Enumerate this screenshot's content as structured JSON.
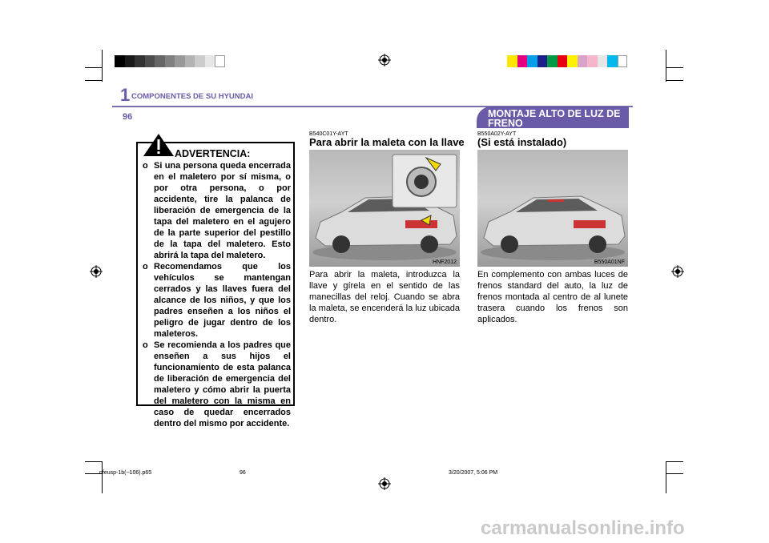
{
  "header": {
    "chapter_number": "1",
    "chapter_title": "COMPONENTES DE SU HYUNDAI",
    "page_number": "96",
    "section_title": "MONTAJE ALTO DE LUZ DE FRENO"
  },
  "warning": {
    "icon": "exclamation-icon",
    "title": "ADVERTENCIA:",
    "bullet": "o",
    "items": [
      "Si una persona queda encerrada en el maletero por sí misma, o por otra persona, o por accidente, tire la palanca de liberación de emergencia de la tapa del maletero en el agujero de la parte superior del pestillo de la tapa del maletero. Esto abrirá la tapa del maletero.",
      "Recomendamos que los vehículos se mantengan cerrados y las llaves fuera del alcance de los niños, y que los padres enseñen a los niños el peligro de jugar dentro de los maleteros.",
      "Se recomienda a los padres que enseñen a sus hijos el funcionamiento de esta palanca de liberación de emergencia del maletero y cómo abrir la puerta del maletero con la misma en caso de quedar encerrados dentro del mismo por accidente."
    ]
  },
  "trunk_section": {
    "code": "B540C01Y-AYT",
    "heading": "Para abrir la maleta con la llave",
    "image_code": "HNF2012",
    "body": "Para abrir la maleta, introduzca la llave y gírela en el sentido de las manecillas del reloj. Cuando se abra la maleta, se encenderá la luz ubicada dentro."
  },
  "brake_light_section": {
    "code": "B550A02Y-AYT",
    "heading": "(Si está instalado)",
    "image_code": "B550A01NF",
    "body": "En complemento con ambas luces de frenos standard del auto, la luz de frenos montada al centro de al lunete trasera cuando los frenos son aplicados."
  },
  "footer": {
    "file": "nfeusp-1b(~106).p65",
    "page": "96",
    "timestamp": "3/20/2007, 5:06 PM"
  },
  "watermark": "carmanualsonline.info",
  "colors": {
    "accent": "#6b5aa8",
    "gray_bar": [
      "#000000",
      "#1a1a1a",
      "#333333",
      "#4d4d4d",
      "#666666",
      "#808080",
      "#999999",
      "#b3b3b3",
      "#cccccc",
      "#e6e6e6",
      "#ffffff"
    ],
    "color_bar": [
      "#ffe600",
      "#e4007f",
      "#00a0e9",
      "#1d2088",
      "#009944",
      "#e60012",
      "#fff100",
      "#d9a3c9",
      "#f5b6cd",
      "#e6e6e6",
      "#00b7ee",
      "#ffffff"
    ]
  }
}
